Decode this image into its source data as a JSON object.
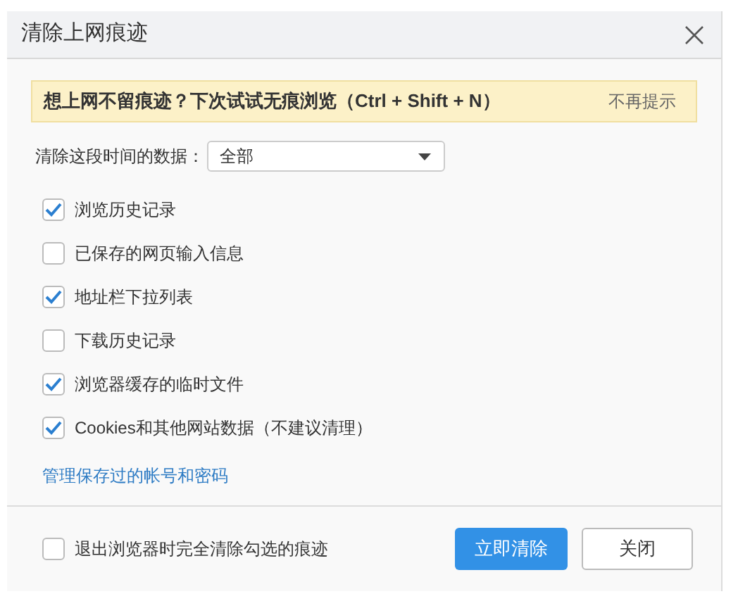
{
  "window": {
    "title": "清除上网痕迹"
  },
  "banner": {
    "message": "想上网不留痕迹？下次试试无痕浏览（Ctrl + Shift + N）",
    "dismiss": "不再提示"
  },
  "time_range": {
    "label": "清除这段时间的数据：",
    "value": "全部"
  },
  "options": [
    {
      "label": "浏览历史记录",
      "checked": true
    },
    {
      "label": "已保存的网页输入信息",
      "checked": false
    },
    {
      "label": "地址栏下拉列表",
      "checked": true
    },
    {
      "label": "下载历史记录",
      "checked": false
    },
    {
      "label": "浏览器缓存的临时文件",
      "checked": true
    },
    {
      "label": "Cookies和其他网站数据（不建议清理）",
      "checked": true
    }
  ],
  "manage_link": "管理保存过的帐号和密码",
  "footer": {
    "exit_option": {
      "label": "退出浏览器时完全清除勾选的痕迹",
      "checked": false
    },
    "buttons": [
      {
        "label": "立即清除",
        "kind": "primary"
      },
      {
        "label": "关闭",
        "kind": "secondary"
      }
    ]
  }
}
